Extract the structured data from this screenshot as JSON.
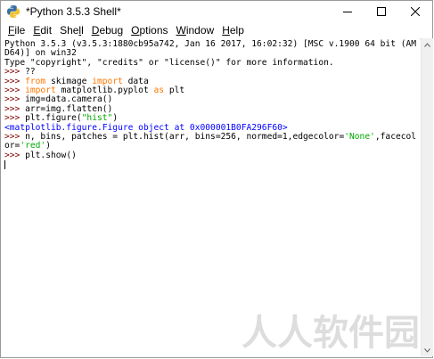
{
  "window": {
    "title": "*Python 3.5.3 Shell*",
    "controls": [
      "minimize",
      "maximize",
      "close"
    ]
  },
  "menu": [
    {
      "label": "File",
      "accel": "F",
      "rest": "ile"
    },
    {
      "label": "Edit",
      "accel": "E",
      "rest": "dit"
    },
    {
      "label": "Shell",
      "accel": "",
      "pre": "She",
      "accel2": "l",
      "rest": "l"
    },
    {
      "label": "Debug",
      "accel": "D",
      "rest": "ebug"
    },
    {
      "label": "Options",
      "accel": "O",
      "rest": "ptions"
    },
    {
      "label": "Window",
      "accel": "W",
      "rest": "indow"
    },
    {
      "label": "Help",
      "accel": "H",
      "rest": "elp"
    }
  ],
  "shell": {
    "banner_line1": "Python 3.5.3 (v3.5.3:1880cb95a742, Jan 16 2017, 16:02:32) [MSC v.1900 64 bit (AM",
    "banner_line2": "D64)] on win32",
    "banner_line3": "Type \"copyright\", \"credits\" or \"license()\" for more information.",
    "prompt": ">>> ",
    "line_q": "??",
    "l_from": "from",
    "l_skimage": " skimage ",
    "l_import1": "import",
    "l_data": " data",
    "l_import2": "import",
    "l_mpl": " matplotlib.pyplot ",
    "l_as": "as",
    "l_plt": " plt",
    "l_img": "img=data.camera()",
    "l_arr": "arr=img.flatten()",
    "l_fig1": "plt.figure(",
    "l_fig_str": "\"hist\"",
    "l_fig2": ")",
    "out_figure": "<matplotlib.figure.Figure object at 0x000001B0FA296F60>",
    "l_hist1": "n, bins, patches = plt.hist(arr, bins=256, normed=1,edgecolor=",
    "l_hist_str1": "'None'",
    "l_hist2": ",facecol",
    "l_hist3": "or=",
    "l_hist_str2": "'red'",
    "l_hist4": ")",
    "l_show": "plt.show()"
  },
  "watermark": "人人软件园",
  "colors": {
    "prompt": "#7f0000",
    "keyword": "#ff7700",
    "string": "#00aa00",
    "output": "#0000ff"
  }
}
